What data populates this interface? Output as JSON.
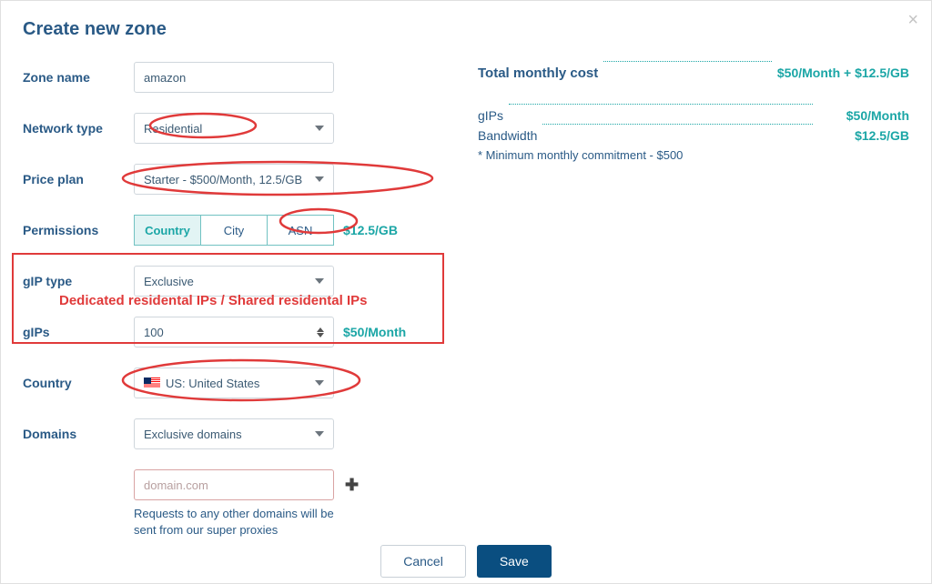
{
  "title": "Create new zone",
  "form": {
    "zone_name": {
      "label": "Zone name",
      "value": "amazon"
    },
    "network_type": {
      "label": "Network type",
      "value": "Residential"
    },
    "price_plan": {
      "label": "Price plan",
      "value": "Starter - $500/Month, 12.5/GB"
    },
    "permissions": {
      "label": "Permissions",
      "tabs": {
        "country": "Country",
        "city": "City",
        "asn": "ASN"
      },
      "price": "$12.5/GB"
    },
    "gip_type": {
      "label": "gIP type",
      "value": "Exclusive"
    },
    "gips": {
      "label": "gIPs",
      "value": "100",
      "price": "$50/Month"
    },
    "country": {
      "label": "Country",
      "value": "US: United States"
    },
    "domains": {
      "label": "Domains",
      "value": "Exclusive domains",
      "placeholder": "domain.com",
      "hint": "Requests to any other domains will be sent from our super proxies"
    }
  },
  "costs": {
    "total_label": "Total monthly cost",
    "total_value": "$50/Month + $12.5/GB",
    "gips_label": "gIPs",
    "gips_value": "$50/Month",
    "bw_label": "Bandwidth",
    "bw_value": "$12.5/GB",
    "min_note": "* Minimum monthly commitment - $500"
  },
  "annotation": {
    "gip_text": "Dedicated residental IPs / Shared residental IPs"
  },
  "buttons": {
    "cancel": "Cancel",
    "save": "Save"
  }
}
